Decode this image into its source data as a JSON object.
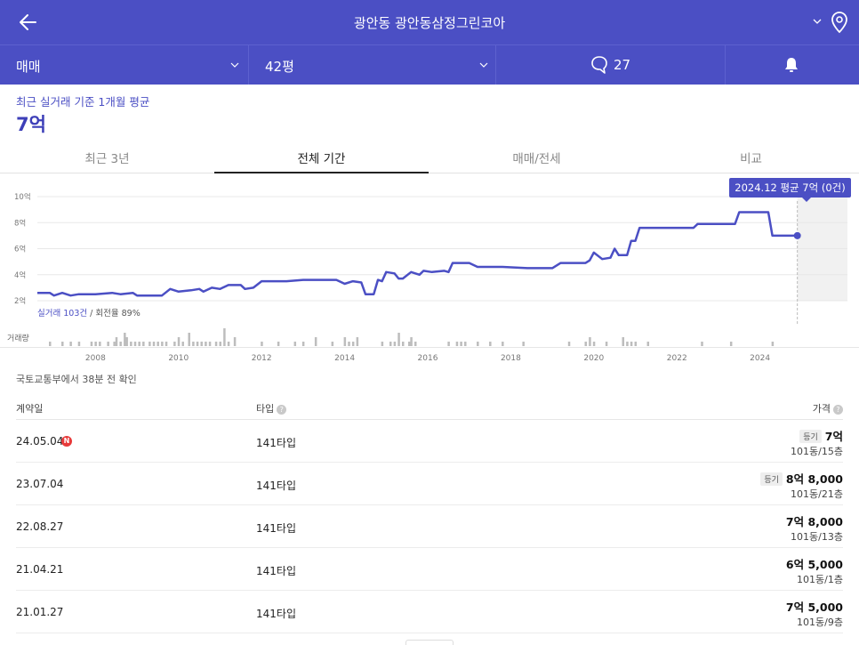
{
  "header": {
    "title": "광안동 광안동삼정그린코아",
    "back_icon": "back-arrow-icon",
    "location_icon": "location-pin-icon"
  },
  "filters": {
    "trade_type": "매매",
    "area": "42평",
    "comments_count": "27",
    "comment_icon": "speech-bubble-icon",
    "alert_icon": "bell-icon"
  },
  "summary": {
    "label": "최근 실거래 기준 1개월 평균",
    "value": "7억"
  },
  "tabs": [
    {
      "label": "최근 3년",
      "active": false
    },
    {
      "label": "전체 기간",
      "active": true
    },
    {
      "label": "매매/전세",
      "active": false
    },
    {
      "label": "비교",
      "active": false
    }
  ],
  "chart": {
    "tooltip": "2024.12 평균 7억 (0건)",
    "trade_count": "실거래 103건",
    "turnover": "/ 회전율 89%",
    "volume_label": "거래량",
    "accent": "#4b4fc4"
  },
  "chart_data": {
    "type": "line",
    "y_ticks": [
      "10억",
      "8억",
      "6억",
      "4억",
      "2억"
    ],
    "ylim": [
      2,
      10
    ],
    "x_ticks": [
      "2008",
      "2010",
      "2012",
      "2014",
      "2016",
      "2018",
      "2020",
      "2022",
      "2024"
    ],
    "xlim": [
      2006.6,
      2025.1
    ],
    "series": [
      {
        "points": [
          [
            2006.6,
            2.6
          ],
          [
            2006.9,
            2.6
          ],
          [
            2007.0,
            2.4
          ],
          [
            2007.2,
            2.6
          ],
          [
            2007.4,
            2.4
          ],
          [
            2007.6,
            2.5
          ],
          [
            2008.0,
            2.5
          ],
          [
            2008.4,
            2.6
          ],
          [
            2008.6,
            2.5
          ],
          [
            2008.9,
            2.6
          ],
          [
            2009.0,
            2.4
          ],
          [
            2009.6,
            2.4
          ],
          [
            2009.8,
            2.9
          ],
          [
            2010.0,
            2.7
          ],
          [
            2010.3,
            2.8
          ],
          [
            2010.5,
            2.9
          ],
          [
            2010.6,
            2.7
          ],
          [
            2010.8,
            3.0
          ],
          [
            2011.0,
            2.9
          ],
          [
            2011.2,
            3.2
          ],
          [
            2011.5,
            3.2
          ],
          [
            2011.6,
            2.9
          ],
          [
            2011.8,
            3.0
          ],
          [
            2012.0,
            3.5
          ],
          [
            2012.4,
            3.5
          ],
          [
            2012.6,
            3.5
          ],
          [
            2013.0,
            3.6
          ],
          [
            2013.5,
            3.6
          ],
          [
            2013.8,
            3.6
          ],
          [
            2014.0,
            3.3
          ],
          [
            2014.2,
            3.5
          ],
          [
            2014.4,
            3.4
          ],
          [
            2014.5,
            2.5
          ],
          [
            2014.7,
            2.5
          ],
          [
            2014.8,
            3.6
          ],
          [
            2014.9,
            3.5
          ],
          [
            2015.0,
            4.2
          ],
          [
            2015.2,
            4.1
          ],
          [
            2015.3,
            3.7
          ],
          [
            2015.4,
            3.7
          ],
          [
            2015.6,
            4.2
          ],
          [
            2015.8,
            4.0
          ],
          [
            2015.9,
            4.3
          ],
          [
            2016.1,
            4.2
          ],
          [
            2016.4,
            4.3
          ],
          [
            2016.5,
            4.2
          ],
          [
            2016.6,
            4.9
          ],
          [
            2017.0,
            4.9
          ],
          [
            2017.2,
            4.6
          ],
          [
            2017.8,
            4.6
          ],
          [
            2018.4,
            4.5
          ],
          [
            2019.0,
            4.5
          ],
          [
            2019.2,
            4.9
          ],
          [
            2019.8,
            4.9
          ],
          [
            2019.9,
            5.1
          ],
          [
            2020.0,
            5.7
          ],
          [
            2020.2,
            5.2
          ],
          [
            2020.4,
            5.3
          ],
          [
            2020.5,
            6.0
          ],
          [
            2020.6,
            5.5
          ],
          [
            2020.8,
            5.5
          ],
          [
            2020.9,
            6.6
          ],
          [
            2021.0,
            6.6
          ],
          [
            2021.1,
            7.6
          ],
          [
            2021.6,
            7.6
          ],
          [
            2022.4,
            7.6
          ],
          [
            2022.5,
            7.9
          ],
          [
            2023.0,
            7.9
          ],
          [
            2023.4,
            7.9
          ],
          [
            2023.5,
            8.8
          ],
          [
            2024.0,
            8.8
          ],
          [
            2024.2,
            8.8
          ],
          [
            2024.3,
            7.0
          ],
          [
            2024.8,
            7.0
          ],
          [
            2024.9,
            7.0
          ]
        ]
      }
    ],
    "volume_years": [
      2006.9,
      2007.2,
      2007.4,
      2007.6,
      2007.9,
      2008.0,
      2008.1,
      2008.3,
      2008.45,
      2008.5,
      2008.6,
      2008.7,
      2008.75,
      2008.85,
      2008.95,
      2009.05,
      2009.15,
      2009.3,
      2009.4,
      2009.5,
      2009.6,
      2009.7,
      2009.9,
      2010.0,
      2010.1,
      2010.25,
      2010.35,
      2010.45,
      2010.55,
      2010.65,
      2010.75,
      2010.9,
      2011.0,
      2011.1,
      2011.2,
      2011.35,
      2012.0,
      2012.4,
      2012.8,
      2013.0,
      2013.3,
      2013.7,
      2014.0,
      2014.1,
      2014.2,
      2014.3,
      2014.9,
      2015.1,
      2015.2,
      2015.3,
      2015.4,
      2015.55,
      2015.6,
      2015.7,
      2016.5,
      2016.7,
      2016.8,
      2016.9,
      2017.2,
      2017.5,
      2017.8,
      2018.3,
      2019.4,
      2019.8,
      2019.9,
      2020.0,
      2020.3,
      2020.7,
      2020.8,
      2020.9,
      2021.0,
      2021.3,
      2022.6,
      2023.3,
      2024.3
    ],
    "volume_values": [
      1,
      1,
      1,
      1,
      1,
      1,
      1,
      1,
      1,
      2,
      1,
      3,
      2,
      1,
      1,
      1,
      1,
      1,
      1,
      1,
      1,
      1,
      1,
      2,
      1,
      3,
      1,
      1,
      1,
      1,
      1,
      1,
      1,
      4,
      1,
      2,
      1,
      1,
      1,
      1,
      2,
      1,
      2,
      1,
      1,
      2,
      1,
      1,
      1,
      3,
      1,
      1,
      2,
      1,
      1,
      1,
      1,
      1,
      1,
      1,
      1,
      1,
      1,
      1,
      2,
      1,
      1,
      2,
      1,
      1,
      1,
      1,
      1,
      1,
      1
    ]
  },
  "source": "국토교통부에서 38분 전 확인",
  "table": {
    "headers": [
      "계약일",
      "타입",
      "가격"
    ],
    "rows": [
      {
        "date": "24.05.04",
        "new": "N",
        "type": "141타입",
        "tag": "등기",
        "price": "7억",
        "unit": "101동/15층"
      },
      {
        "date": "23.07.04",
        "new": "",
        "type": "141타입",
        "tag": "등기",
        "price": "8억 8,000",
        "unit": "101동/21층"
      },
      {
        "date": "22.08.27",
        "new": "",
        "type": "141타입",
        "tag": "",
        "price": "7억 8,000",
        "unit": "101동/13층"
      },
      {
        "date": "21.04.21",
        "new": "",
        "type": "141타입",
        "tag": "",
        "price": "6억 5,000",
        "unit": "101동/1층"
      },
      {
        "date": "21.01.27",
        "new": "",
        "type": "141타입",
        "tag": "",
        "price": "7억 5,000",
        "unit": "101동/9층"
      }
    ]
  }
}
